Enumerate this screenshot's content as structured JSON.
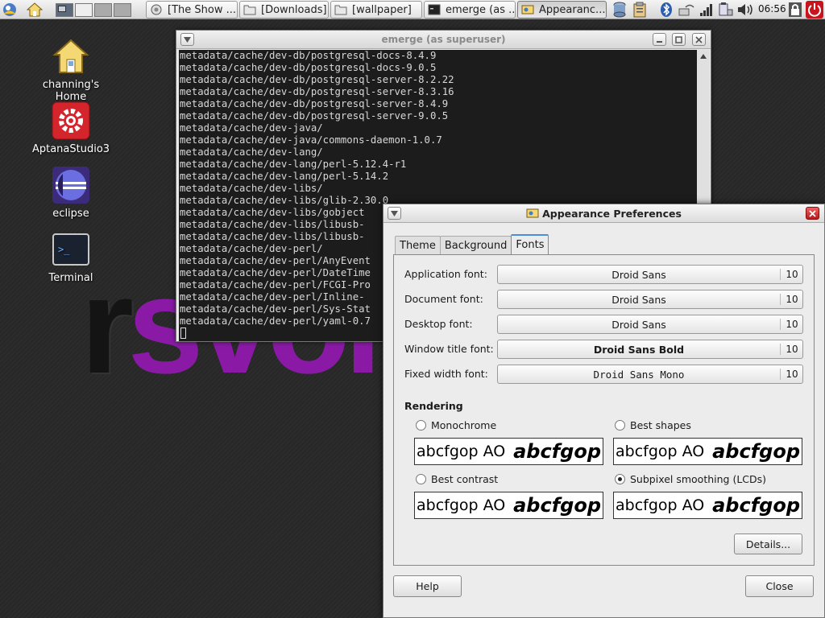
{
  "panel": {
    "tasks": [
      {
        "label": "[The Show ..."
      },
      {
        "label": "[Downloads]"
      },
      {
        "label": "[wallpaper]"
      },
      {
        "label": "emerge (as ..."
      },
      {
        "label": "Appearanc..."
      }
    ],
    "clock": "06:56"
  },
  "desktop": {
    "icons": [
      {
        "label": "channing's Home"
      },
      {
        "label": "AptanaStudio3"
      },
      {
        "label": "eclipse"
      },
      {
        "label": "Terminal"
      }
    ],
    "wallpaper": {
      "part1": "r",
      "part2": "svol"
    }
  },
  "terminal": {
    "title": "emerge (as superuser)",
    "lines": [
      "metadata/cache/dev-db/postgresql-docs-8.4.9",
      "metadata/cache/dev-db/postgresql-docs-9.0.5",
      "metadata/cache/dev-db/postgresql-server-8.2.22",
      "metadata/cache/dev-db/postgresql-server-8.3.16",
      "metadata/cache/dev-db/postgresql-server-8.4.9",
      "metadata/cache/dev-db/postgresql-server-9.0.5",
      "metadata/cache/dev-java/",
      "metadata/cache/dev-java/commons-daemon-1.0.7",
      "metadata/cache/dev-lang/",
      "metadata/cache/dev-lang/perl-5.12.4-r1",
      "metadata/cache/dev-lang/perl-5.14.2",
      "metadata/cache/dev-libs/",
      "metadata/cache/dev-libs/glib-2.30.0",
      "metadata/cache/dev-libs/gobject",
      "metadata/cache/dev-libs/libusb-",
      "metadata/cache/dev-libs/libusb-",
      "metadata/cache/dev-perl/",
      "metadata/cache/dev-perl/AnyEvent",
      "metadata/cache/dev-perl/DateTime",
      "metadata/cache/dev-perl/FCGI-Pro",
      "metadata/cache/dev-perl/Inline-",
      "metadata/cache/dev-perl/Sys-Stat",
      "metadata/cache/dev-perl/yaml-0.7"
    ]
  },
  "dialog": {
    "title": "Appearance Preferences",
    "tabs": [
      "Theme",
      "Background",
      "Fonts"
    ],
    "fonts": [
      {
        "label": "Application font:",
        "font": "Droid Sans",
        "size": "10"
      },
      {
        "label": "Document font:",
        "font": "Droid Sans",
        "size": "10"
      },
      {
        "label": "Desktop font:",
        "font": "Droid Sans",
        "size": "10"
      },
      {
        "label": "Window title font:",
        "font": "Droid Sans Bold",
        "size": "10"
      },
      {
        "label": "Fixed width font:",
        "font": "Droid Sans Mono",
        "size": "10"
      }
    ],
    "rendering": {
      "heading": "Rendering",
      "options": [
        {
          "label": "Monochrome",
          "selected": false
        },
        {
          "label": "Best shapes",
          "selected": false
        },
        {
          "label": "Best contrast",
          "selected": false
        },
        {
          "label": "Subpixel smoothing (LCDs)",
          "selected": true
        }
      ],
      "sample_small": "abcfgop AO",
      "sample_large": "abcfgop"
    },
    "details_button": "Details...",
    "help_button": "Help",
    "close_button": "Close"
  }
}
